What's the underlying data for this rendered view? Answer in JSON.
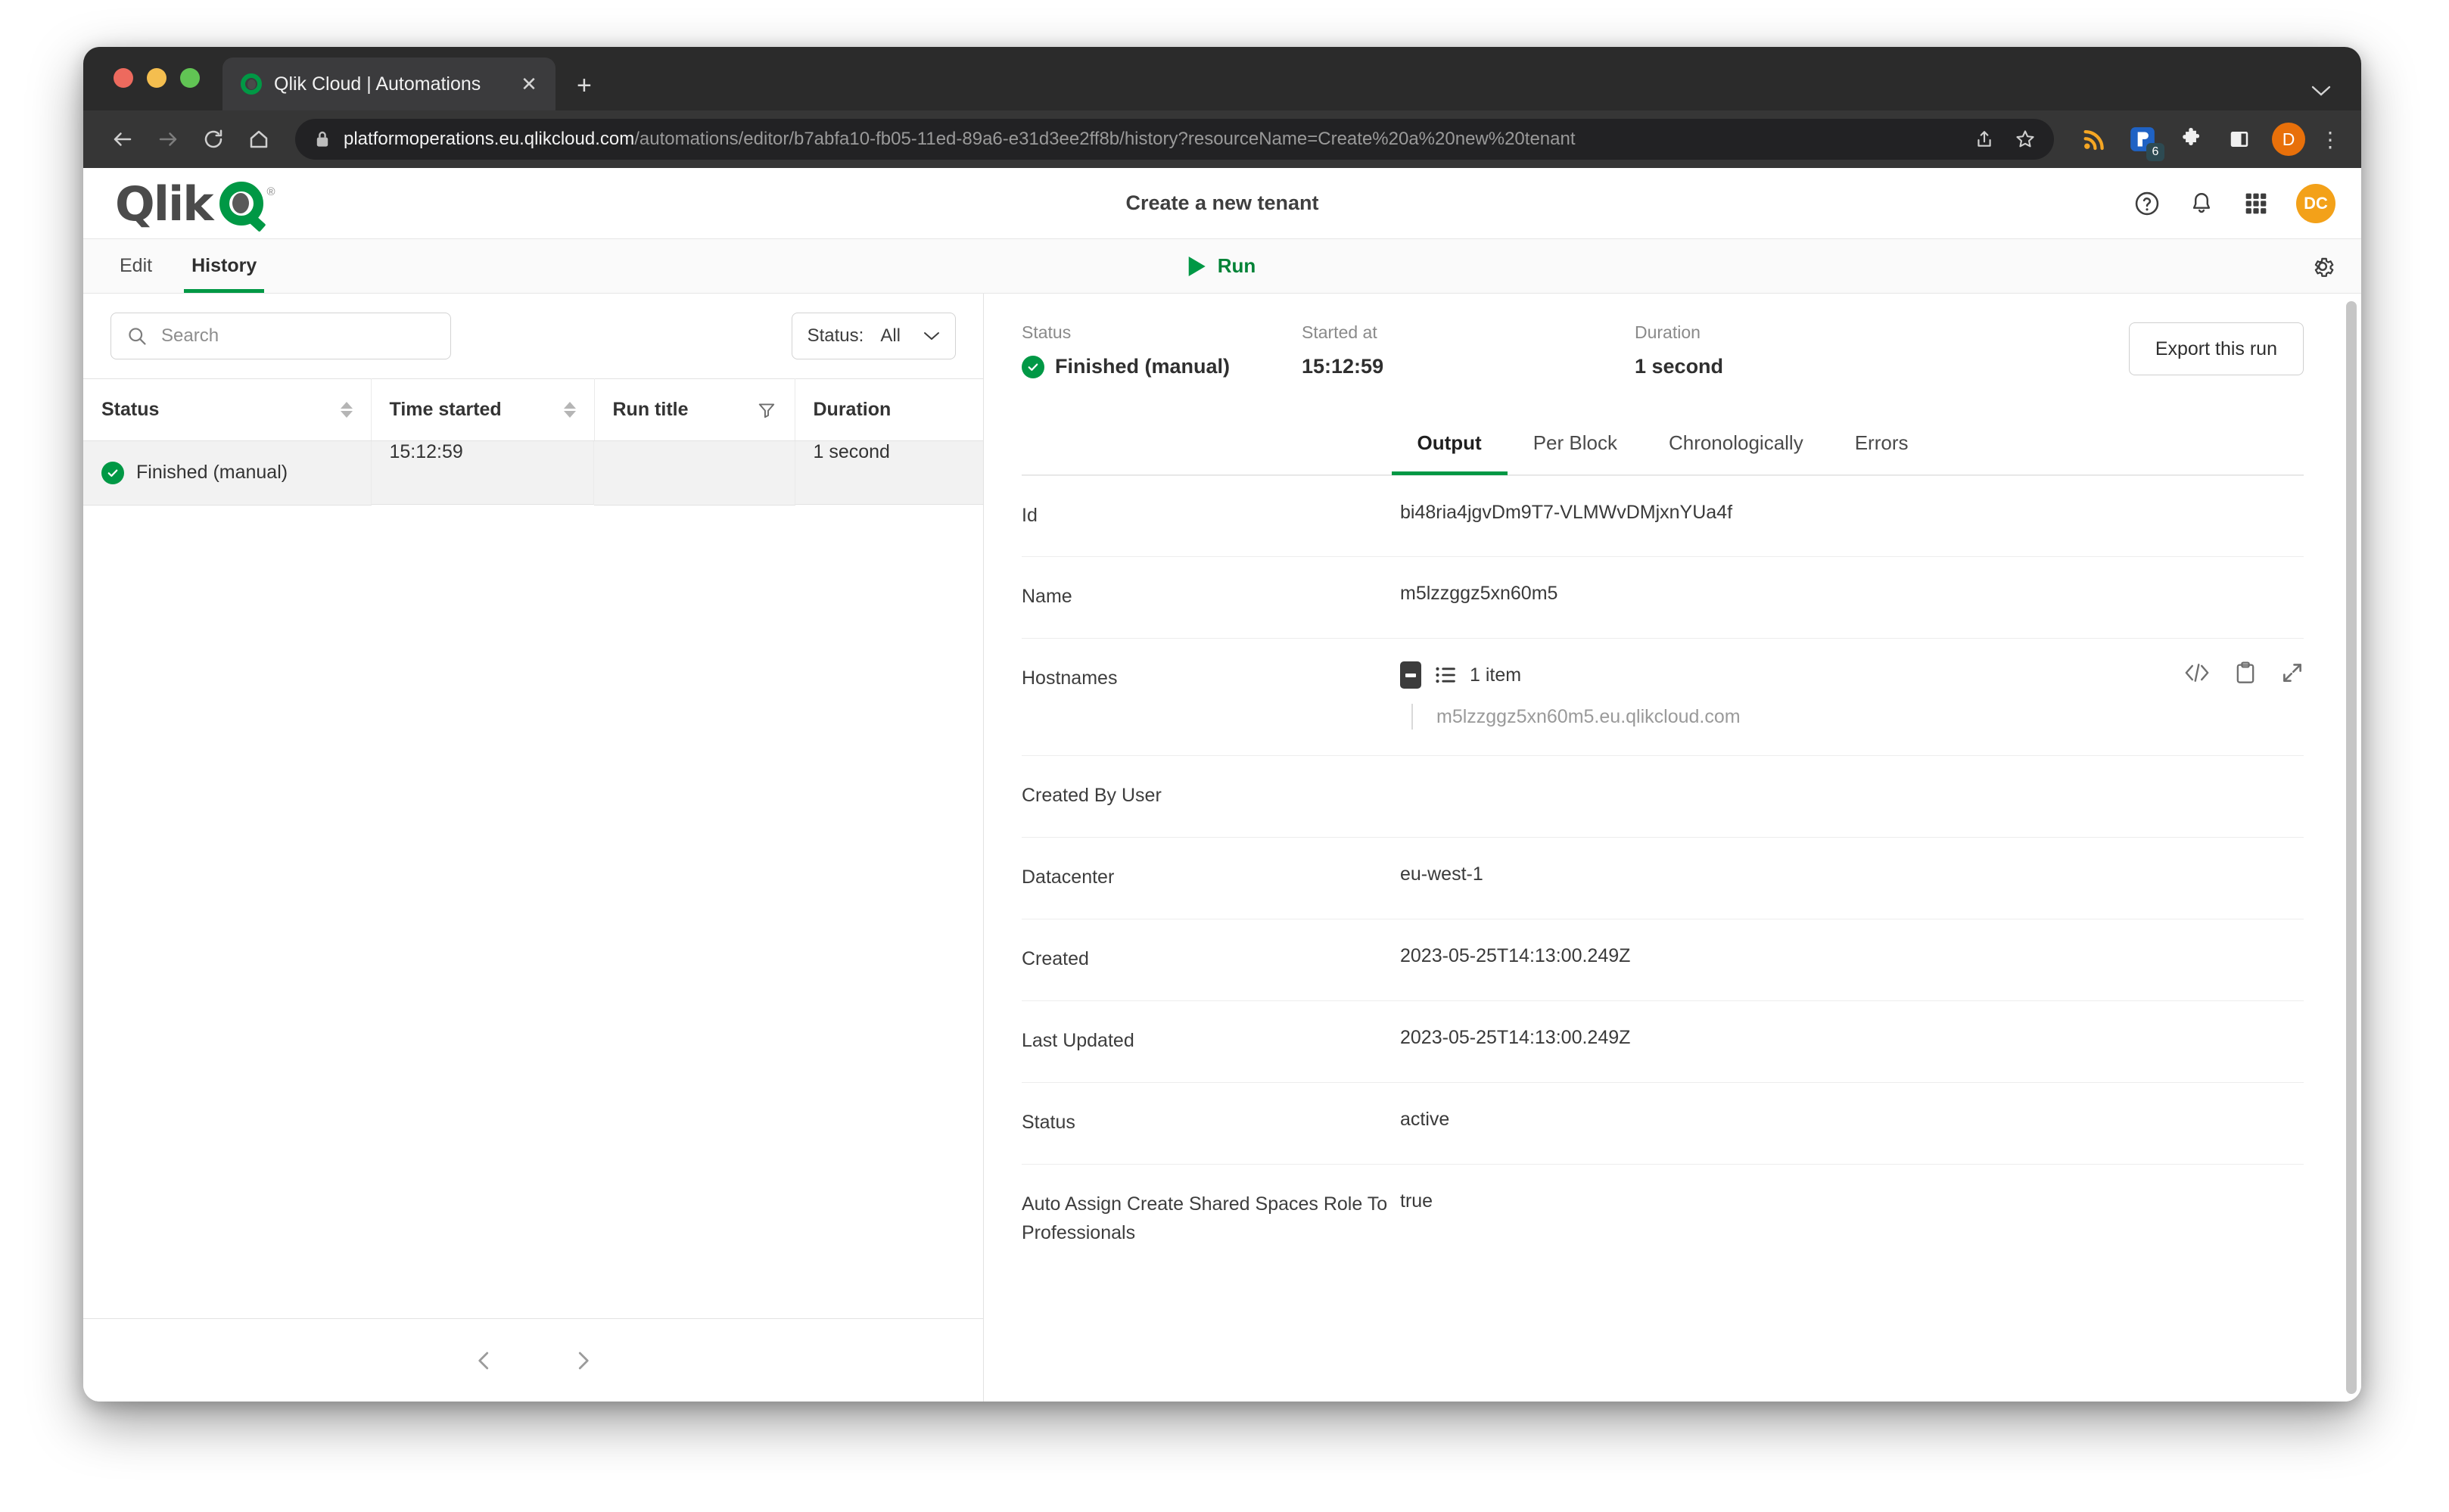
{
  "browser": {
    "tab_title": "Qlik Cloud | Automations",
    "tab_favicon": "qlik-q-icon",
    "new_tab_label": "+",
    "close_label": "✕",
    "url_host": "platformoperations.eu.qlikcloud.com",
    "url_path": "/automations/editor/b7abfa10-fb05-11ed-89a6-e31d3ee2ff8b/history?resourceName=Create%20a%20new%20tenant",
    "extension_badge_count": "6",
    "profile_initial": "D",
    "menu_glyph": "⋮"
  },
  "app_header": {
    "logo_word": "Qlik",
    "logo_registered": "®",
    "title": "Create a new tenant",
    "avatar_initials": "DC"
  },
  "toolbar": {
    "tabs": [
      {
        "label": "Edit",
        "active": false
      },
      {
        "label": "History",
        "active": true
      }
    ],
    "run_label": "Run",
    "settings_icon": "gear-icon"
  },
  "left_panel": {
    "search_placeholder": "Search",
    "search_value": "",
    "status_filter_label": "Status:",
    "status_filter_value": "All",
    "columns": [
      "Status",
      "Time started",
      "Run title",
      "Duration"
    ],
    "rows": [
      {
        "status": "Finished (manual)",
        "time_started": "15:12:59",
        "run_title": "",
        "duration": "1 second"
      }
    ],
    "pager_prev": "‹",
    "pager_next": "›"
  },
  "run_detail": {
    "status_label": "Status",
    "status_value": "Finished (manual)",
    "started_label": "Started at",
    "started_value": "15:12:59",
    "duration_label": "Duration",
    "duration_value": "1 second",
    "export_label": "Export this run",
    "tabs": [
      {
        "label": "Output",
        "active": true
      },
      {
        "label": "Per Block",
        "active": false
      },
      {
        "label": "Chronologically",
        "active": false
      },
      {
        "label": "Errors",
        "active": false
      }
    ],
    "fields": [
      {
        "key": "Id",
        "value": "bi48ria4jgvDm9T7-VLMWvDMjxnYUa4f"
      },
      {
        "key": "Name",
        "value": "m5lzzggz5xn60m5"
      },
      {
        "key": "Created By User",
        "value": ""
      },
      {
        "key": "Datacenter",
        "value": "eu-west-1"
      },
      {
        "key": "Created",
        "value": "2023-05-25T14:13:00.249Z"
      },
      {
        "key": "Last Updated",
        "value": "2023-05-25T14:13:00.249Z"
      },
      {
        "key": "Status",
        "value": "active"
      },
      {
        "key": "Auto Assign Create Shared Spaces Role To Professionals",
        "value": "true"
      }
    ],
    "hostnames": {
      "key": "Hostnames",
      "count_label": "1 item",
      "items": [
        "m5lzzggz5xn60m5.eu.qlikcloud.com"
      ],
      "actions": [
        "code-icon",
        "clipboard-icon",
        "expand-icon"
      ]
    }
  },
  "colors": {
    "qlik_green": "#009845",
    "avatar_orange": "#f3a119",
    "profile_orange": "#e8700a",
    "chrome_dark": "#2b2b2b"
  }
}
